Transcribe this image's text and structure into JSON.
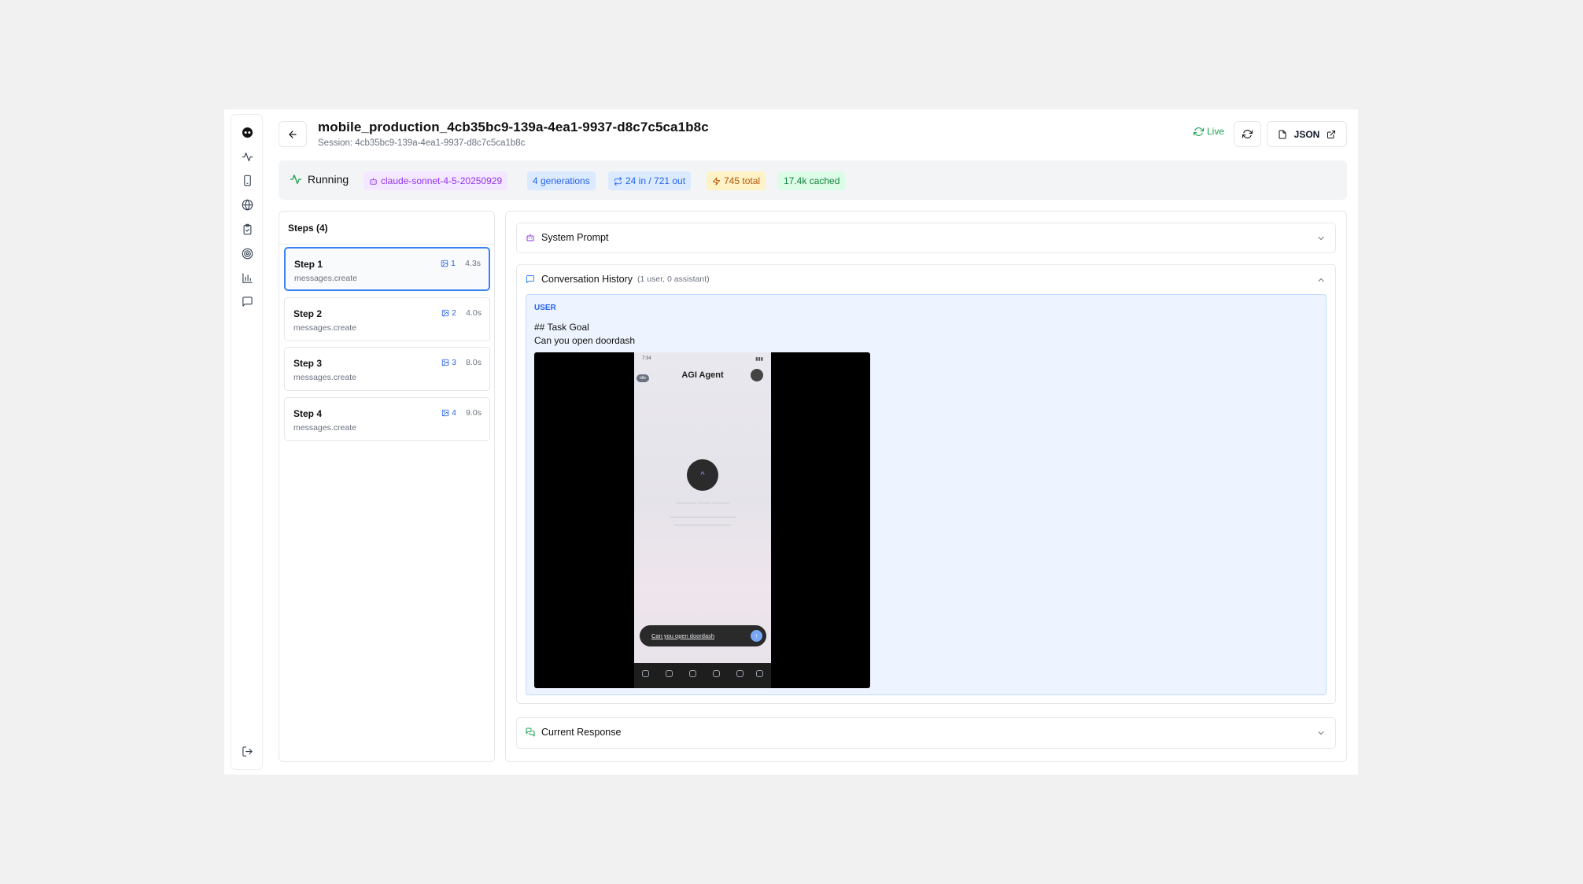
{
  "header": {
    "title": "mobile_production_4cb35bc9-139a-4ea1-9937-d8c7c5ca1b8c",
    "subtitle": "Session: 4cb35bc9-139a-4ea1-9937-d8c7c5ca1b8c",
    "live_label": "Live",
    "json_label": "JSON"
  },
  "status": {
    "state": "Running",
    "model": "claude-sonnet-4-5-20250929",
    "generations": "4 generations",
    "tokens_io": "24 in / 721 out",
    "total": "745 total",
    "cached": "17.4k cached"
  },
  "steps": {
    "header": "Steps (4)",
    "items": [
      {
        "title": "Step 1",
        "method": "messages.create",
        "images": "1",
        "time": "4.3s"
      },
      {
        "title": "Step 2",
        "method": "messages.create",
        "images": "2",
        "time": "4.0s"
      },
      {
        "title": "Step 3",
        "method": "messages.create",
        "images": "3",
        "time": "8.0s"
      },
      {
        "title": "Step 4",
        "method": "messages.create",
        "images": "4",
        "time": "9.0s"
      }
    ]
  },
  "sections": {
    "system_prompt": "System Prompt",
    "conversation": "Conversation History",
    "conversation_note": "(1 user, 0 assistant)",
    "current_response": "Current Response"
  },
  "message": {
    "role": "USER",
    "line1": "## Task Goal",
    "line2": "Can you open doordash"
  },
  "phone": {
    "status_time": "7:34",
    "app_title": "AGI Agent",
    "pill": "Idle",
    "input_text": "Can you open doordash"
  },
  "colors": {
    "accent_blue": "#3b82f6",
    "live_green": "#16a34a",
    "model_purple": "#9333ea"
  }
}
